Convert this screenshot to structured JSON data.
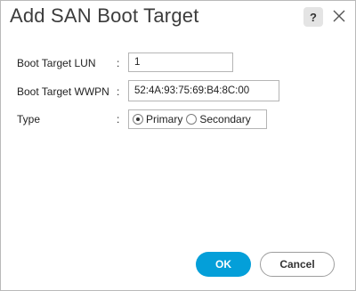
{
  "dialog": {
    "title": "Add SAN Boot Target",
    "help_label": "?",
    "close_icon": "close-icon"
  },
  "form": {
    "lun": {
      "label": "Boot Target LUN",
      "colon": ":",
      "value": "1"
    },
    "wwpn": {
      "label": "Boot Target WWPN",
      "colon": ":",
      "value": "52:4A:93:75:69:B4:8C:00"
    },
    "type": {
      "label": "Type",
      "colon": ":",
      "options": [
        {
          "label": "Primary",
          "selected": true
        },
        {
          "label": "Secondary",
          "selected": false
        }
      ]
    }
  },
  "buttons": {
    "ok": "OK",
    "cancel": "Cancel"
  },
  "colors": {
    "primary_button": "#049fd9",
    "border": "#b5b5b5"
  }
}
